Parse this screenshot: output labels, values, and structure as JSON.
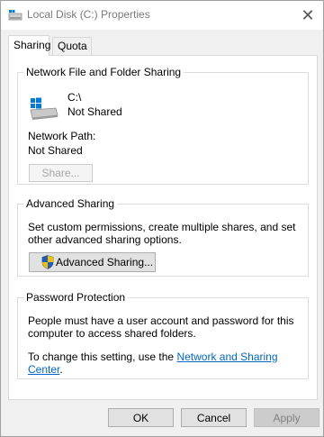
{
  "window": {
    "title": "Local Disk (C:) Properties",
    "close_symbol": "✕"
  },
  "tabs": [
    {
      "label": "Sharing",
      "active": true
    },
    {
      "label": "Quota",
      "active": false
    }
  ],
  "network_sharing": {
    "legend": "Network File and Folder Sharing",
    "drive_path": "C:\\",
    "drive_status": "Not Shared",
    "network_path_label": "Network Path:",
    "network_path_value": "Not Shared",
    "share_button": "Share..."
  },
  "advanced_sharing": {
    "legend": "Advanced Sharing",
    "description": "Set custom permissions, create multiple shares, and set other advanced sharing options.",
    "button": "Advanced Sharing..."
  },
  "password_protection": {
    "legend": "Password Protection",
    "description": "People must have a user account and password for this computer to access shared folders.",
    "change_prefix": "To change this setting, use the ",
    "link": "Network and Sharing Center",
    "change_suffix": "."
  },
  "footer": {
    "ok": "OK",
    "cancel": "Cancel",
    "apply": "Apply"
  },
  "colors": {
    "link": "#0066cc",
    "windows_blue": "#0078d7",
    "shield_blue": "#1f5fbf",
    "shield_yellow": "#f2c200"
  }
}
